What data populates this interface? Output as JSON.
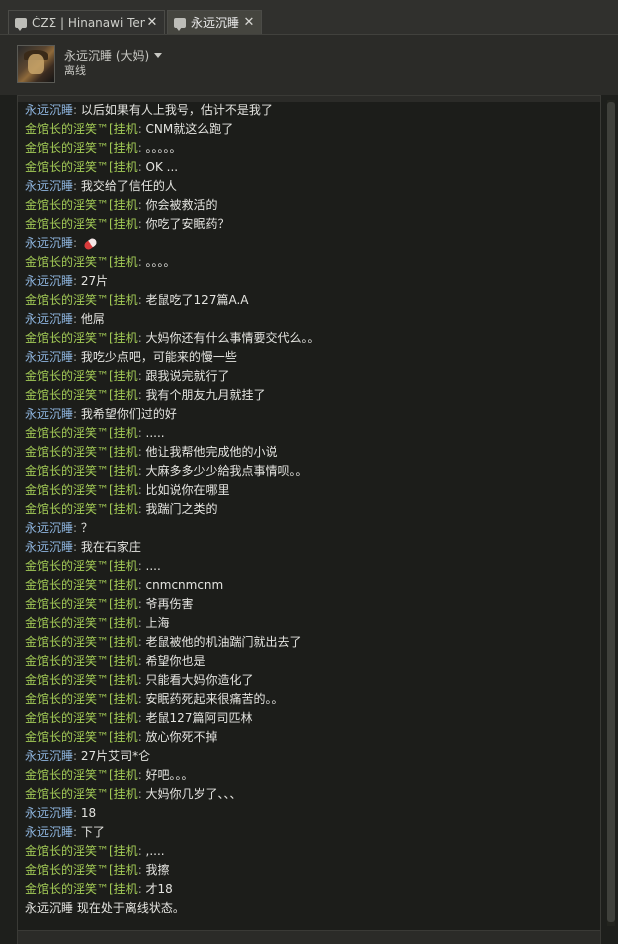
{
  "tabs": [
    {
      "label": "ĆZΣ | Hinanawi Tenshi",
      "icon": "chat-bubble-icon"
    },
    {
      "label": "永远沉睡",
      "icon": "chat-bubble-icon"
    }
  ],
  "header": {
    "name": "永远沉睡 (大妈)",
    "status": "离线"
  },
  "senders": {
    "self": "永远沉睡",
    "friend": "金馆长的淫笑™[挂机"
  },
  "messages": [
    {
      "who": "self",
      "sender": "永远沉睡",
      "text": "以后如果有人上我号，估计不是我了"
    },
    {
      "who": "friend",
      "sender": "金馆长的淫笑™[挂机",
      "text": "CNM就这么跑了"
    },
    {
      "who": "friend",
      "sender": "金馆长的淫笑™[挂机",
      "text": "。。。。。"
    },
    {
      "who": "friend",
      "sender": "金馆长的淫笑™[挂机",
      "text": "OK ..."
    },
    {
      "who": "self",
      "sender": "永远沉睡",
      "text": "我交给了信任的人"
    },
    {
      "who": "friend",
      "sender": "金馆长的淫笑™[挂机",
      "text": "你会被救活的"
    },
    {
      "who": "friend",
      "sender": "金馆长的淫笑™[挂机",
      "text": "你吃了安眠药？"
    },
    {
      "who": "self",
      "sender": "永远沉睡",
      "text": "",
      "emote": "pill-icon"
    },
    {
      "who": "friend",
      "sender": "金馆长的淫笑™[挂机",
      "text": "。。。。"
    },
    {
      "who": "self",
      "sender": "永远沉睡",
      "text": "27片"
    },
    {
      "who": "friend",
      "sender": "金馆长的淫笑™[挂机",
      "text": "老鼠吃了127篇A.A"
    },
    {
      "who": "self",
      "sender": "永远沉睡",
      "text": "他屌"
    },
    {
      "who": "friend",
      "sender": "金馆长的淫笑™[挂机",
      "text": "大妈你还有什么事情要交代么。。"
    },
    {
      "who": "self",
      "sender": "永远沉睡",
      "text": "我吃少点吧，可能来的慢一些"
    },
    {
      "who": "friend",
      "sender": "金馆长的淫笑™[挂机",
      "text": "跟我说完就行了"
    },
    {
      "who": "friend",
      "sender": "金馆长的淫笑™[挂机",
      "text": "我有个朋友九月就挂了"
    },
    {
      "who": "self",
      "sender": "永远沉睡",
      "text": "我希望你们过的好"
    },
    {
      "who": "friend",
      "sender": "金馆长的淫笑™[挂机",
      "text": "....."
    },
    {
      "who": "friend",
      "sender": "金馆长的淫笑™[挂机",
      "text": "他让我帮他完成他的小说"
    },
    {
      "who": "friend",
      "sender": "金馆长的淫笑™[挂机",
      "text": "大麻多多少少給我点事情呗。。"
    },
    {
      "who": "friend",
      "sender": "金馆长的淫笑™[挂机",
      "text": "比如说你在哪里"
    },
    {
      "who": "friend",
      "sender": "金馆长的淫笑™[挂机",
      "text": "我踹门之类的"
    },
    {
      "who": "self",
      "sender": "永远沉睡",
      "text": "？"
    },
    {
      "who": "self",
      "sender": "永远沉睡",
      "text": "我在石家庄"
    },
    {
      "who": "friend",
      "sender": "金馆长的淫笑™[挂机",
      "text": "...."
    },
    {
      "who": "friend",
      "sender": "金馆长的淫笑™[挂机",
      "text": "cnmcnmcnm"
    },
    {
      "who": "friend",
      "sender": "金馆长的淫笑™[挂机",
      "text": "爷再伤害"
    },
    {
      "who": "friend",
      "sender": "金馆长的淫笑™[挂机",
      "text": "上海"
    },
    {
      "who": "friend",
      "sender": "金馆长的淫笑™[挂机",
      "text": "老鼠被他的机油踹门就出去了"
    },
    {
      "who": "friend",
      "sender": "金馆长的淫笑™[挂机",
      "text": "希望你也是"
    },
    {
      "who": "friend",
      "sender": "金馆长的淫笑™[挂机",
      "text": "只能看大妈你造化了"
    },
    {
      "who": "friend",
      "sender": "金馆长的淫笑™[挂机",
      "text": "安眠药死起来很痛苦的。。"
    },
    {
      "who": "friend",
      "sender": "金馆长的淫笑™[挂机",
      "text": "老鼠127篇阿司匹林"
    },
    {
      "who": "friend",
      "sender": "金馆长的淫笑™[挂机",
      "text": "放心你死不掉"
    },
    {
      "who": "self",
      "sender": "永远沉睡",
      "text": "27片艾司*仑"
    },
    {
      "who": "friend",
      "sender": "金馆长的淫笑™[挂机",
      "text": "好吧。。。"
    },
    {
      "who": "friend",
      "sender": "金馆长的淫笑™[挂机",
      "text": "大妈你几岁了、、、"
    },
    {
      "who": "self",
      "sender": "永远沉睡",
      "text": "18"
    },
    {
      "who": "self",
      "sender": "永远沉睡",
      "text": "下了"
    },
    {
      "who": "friend",
      "sender": "金馆长的淫笑™[挂机",
      "text": ",...."
    },
    {
      "who": "friend",
      "sender": "金馆长的淫笑™[挂机",
      "text": "我擦"
    },
    {
      "who": "friend",
      "sender": "金馆长的淫笑™[挂机",
      "text": "才18"
    }
  ],
  "offline_notice": "永远沉睡 现在处于离线状态。",
  "colors": {
    "friend_name": "#a3cb56",
    "self_name": "#8fb6e0",
    "message_text": "#e4e4e0",
    "background": "#1c1d1a"
  }
}
